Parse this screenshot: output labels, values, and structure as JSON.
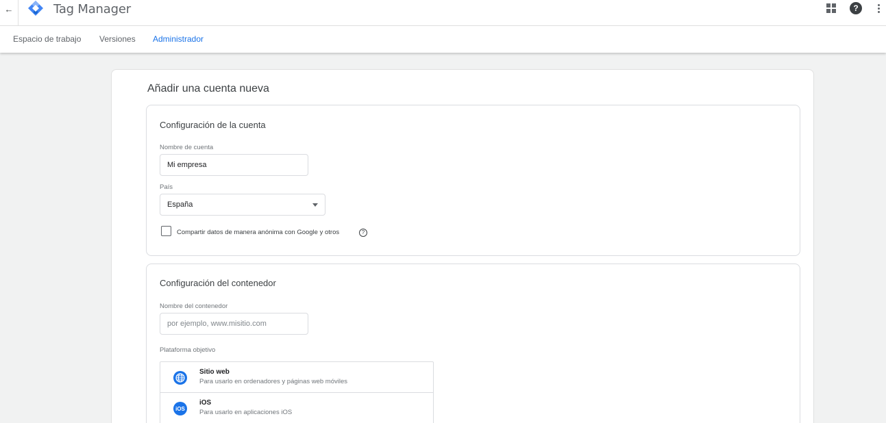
{
  "header": {
    "back_icon": "arrow-back-icon",
    "app_title": "Tag Manager",
    "logo_icon": "tag-manager-logo",
    "apps_icon": "apps-grid-icon",
    "help_icon": "help-icon",
    "more_icon": "more-vert-icon"
  },
  "nav": {
    "tabs": [
      {
        "label": "Espacio de trabajo",
        "active": false
      },
      {
        "label": "Versiones",
        "active": false
      },
      {
        "label": "Administrador",
        "active": true
      }
    ]
  },
  "page": {
    "title": "Añadir una cuenta nueva"
  },
  "account_section": {
    "title": "Configuración de la cuenta",
    "account_name_label": "Nombre de cuenta",
    "account_name_value": "Mi empresa",
    "country_label": "País",
    "country_value": "España",
    "share_data_label": "Compartir datos de manera anónima con Google y otros",
    "share_data_checked": false,
    "help_glyph": "?"
  },
  "container_section": {
    "title": "Configuración del contenedor",
    "container_name_label": "Nombre del contenedor",
    "container_name_placeholder": "por ejemplo, www.misitio.com",
    "platform_label": "Plataforma objetivo",
    "platforms": [
      {
        "name": "Sitio web",
        "description": "Para usarlo en ordenadores y páginas web móviles",
        "icon": "globe-icon"
      },
      {
        "name": "iOS",
        "description": "Para usarlo en aplicaciones iOS",
        "icon": "ios-icon",
        "icon_text": "iOS"
      }
    ]
  },
  "colors": {
    "accent": "#1a73e8",
    "background": "#f1f2f2",
    "logo_blue": "#4285f4",
    "logo_dark": "#1967d2"
  }
}
